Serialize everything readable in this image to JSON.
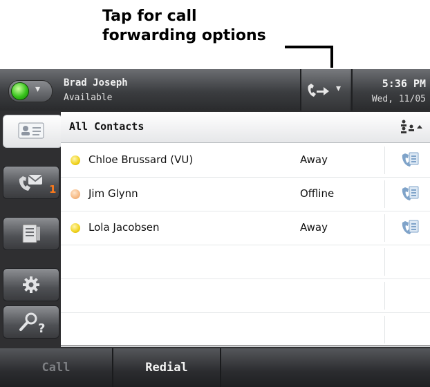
{
  "annotation": {
    "line1": "Tap for call",
    "line2": "forwarding options"
  },
  "header": {
    "user_name": "Brad Joseph",
    "user_status": "Available",
    "time": "5:36 PM",
    "date": "Wed, 11/05"
  },
  "sidebar": {
    "tabs": [
      {
        "name": "contacts",
        "icon": "contact-card-icon",
        "active": true
      },
      {
        "name": "messages",
        "icon": "voicemail-icon",
        "badge": "1"
      },
      {
        "name": "directory",
        "icon": "directory-icon"
      },
      {
        "name": "settings",
        "icon": "gear-icon"
      },
      {
        "name": "help",
        "icon": "help-search-icon"
      }
    ]
  },
  "contacts": {
    "title": "All Contacts",
    "rows": [
      {
        "name": "Chloe Brussard (VU)",
        "status": "Away",
        "presence": "away"
      },
      {
        "name": "Jim Glynn",
        "status": "Offline",
        "presence": "offline"
      },
      {
        "name": "Lola Jacobsen",
        "status": "Away",
        "presence": "away"
      }
    ]
  },
  "softkeys": {
    "call": "Call",
    "redial": "Redial"
  },
  "colors": {
    "presence_available": "#37c21c",
    "presence_away": "#f0d21c",
    "presence_offline": "#f6b983",
    "badge": "#ff7a1a"
  }
}
